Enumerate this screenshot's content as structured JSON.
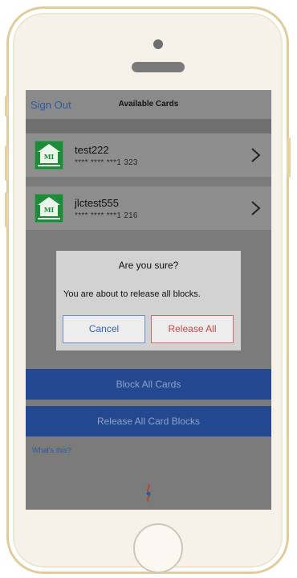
{
  "navbar": {
    "sign_out_label": "Sign Out",
    "title": "Available Cards"
  },
  "cards": [
    {
      "name": "test222",
      "number": "**** **** ***1 323",
      "logo_text": "MI"
    },
    {
      "name": "jlctest555",
      "number": "**** **** ***1 216",
      "logo_text": "MI"
    }
  ],
  "dialog": {
    "title": "Are you sure?",
    "message": "You are about to release all blocks.",
    "cancel_label": "Cancel",
    "release_label": "Release All"
  },
  "actions": {
    "block_all_label": "Block All Cards",
    "release_all_label": "Release All Card Blocks"
  },
  "help": {
    "whats_this_label": "What's this?"
  },
  "colors": {
    "brand_blue": "#23488f",
    "link_blue": "#2c5aa0",
    "logo_green": "#1f8a3a",
    "danger_red": "#c84646"
  },
  "icons": [
    "chevron-right-icon",
    "app-logo-icon",
    "brand-logo-icon",
    "home-button-icon"
  ]
}
